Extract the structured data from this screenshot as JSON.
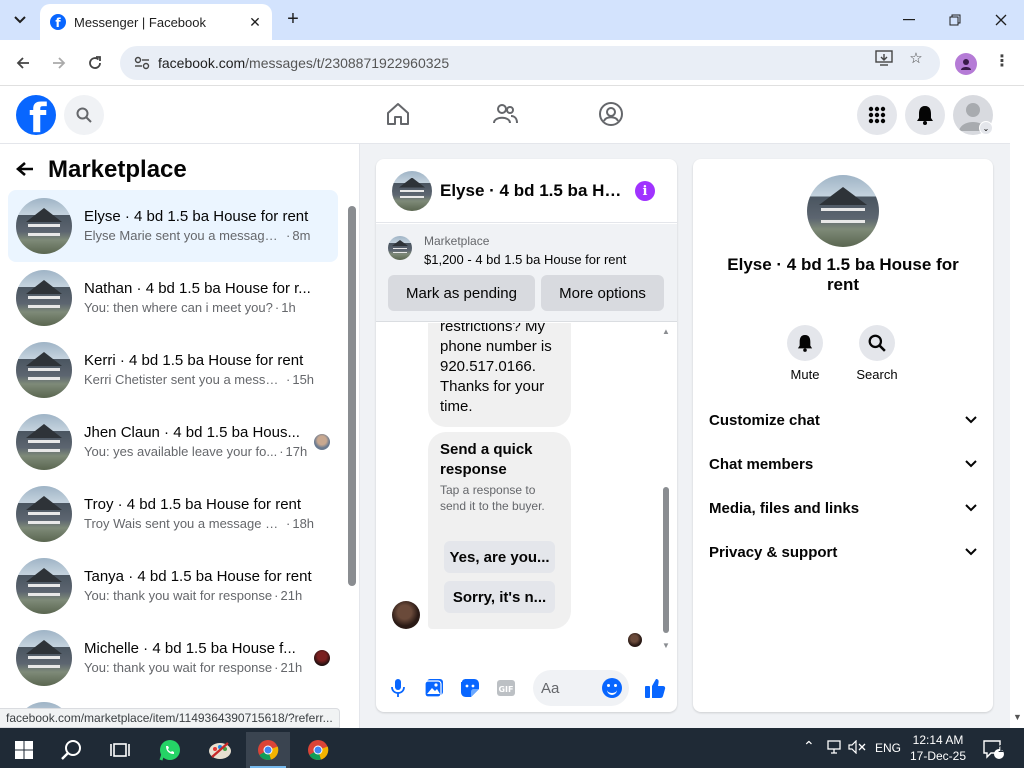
{
  "browser": {
    "tab_title": "Messenger | Facebook",
    "url_host": "facebook.com",
    "url_path": "/messages/t/2308871922960325",
    "status_url": "facebook.com/marketplace/item/1149364390715618/?referr..."
  },
  "left": {
    "title": "Marketplace",
    "conversations": [
      {
        "name": "Elyse · 4 bd 1.5 ba House for rent",
        "msg": "Elyse Marie sent you a message ab...",
        "time": "8m"
      },
      {
        "name": "Nathan · 4 bd 1.5 ba House for r...",
        "msg": "You: then where can i meet you?",
        "time": "1h"
      },
      {
        "name": "Kerri · 4 bd 1.5 ba House for rent",
        "msg": "Kerri Chetister sent you a messag...",
        "time": "15h"
      },
      {
        "name": "Jhen Claun · 4 bd 1.5 ba Hous...",
        "msg": "You: yes available leave your fo...",
        "time": "17h"
      },
      {
        "name": "Troy · 4 bd 1.5 ba House for rent",
        "msg": "Troy Wais sent you a message abo...",
        "time": "18h"
      },
      {
        "name": "Tanya · 4 bd 1.5 ba House for rent",
        "msg": "You: thank you wait for response",
        "time": "21h"
      },
      {
        "name": "Michelle · 4 bd 1.5 ba House f...",
        "msg": "You: thank you wait for response",
        "time": "21h"
      }
    ]
  },
  "chat": {
    "title": "Elyse · 4 bd 1.5 ba Ho...",
    "marketplace_label": "Marketplace",
    "listing": "$1,200 - 4 bd 1.5 ba House for rent",
    "mark_pending": "Mark as pending",
    "more_options": "More options",
    "message_text": "restrictions? My phone number is 920.517.0166. Thanks for your time.",
    "quick_title": "Send a quick response",
    "quick_sub": "Tap a response to send it to the buyer.",
    "quick_1": "Yes, are you...",
    "quick_2": "Sorry, it's n...",
    "input_placeholder": "Aa"
  },
  "details": {
    "name": "Elyse · 4 bd 1.5 ba House for rent",
    "mute": "Mute",
    "search": "Search",
    "rows": [
      "Customize chat",
      "Chat members",
      "Media, files and links",
      "Privacy & support"
    ]
  },
  "taskbar": {
    "lang": "ENG",
    "time": "12:14 AM",
    "date": "17-Dec-25",
    "notif_count": "1"
  },
  "colors": {
    "fb_blue": "#0866ff",
    "active_row": "#ebf5ff",
    "info_purple": "#a033ff"
  }
}
